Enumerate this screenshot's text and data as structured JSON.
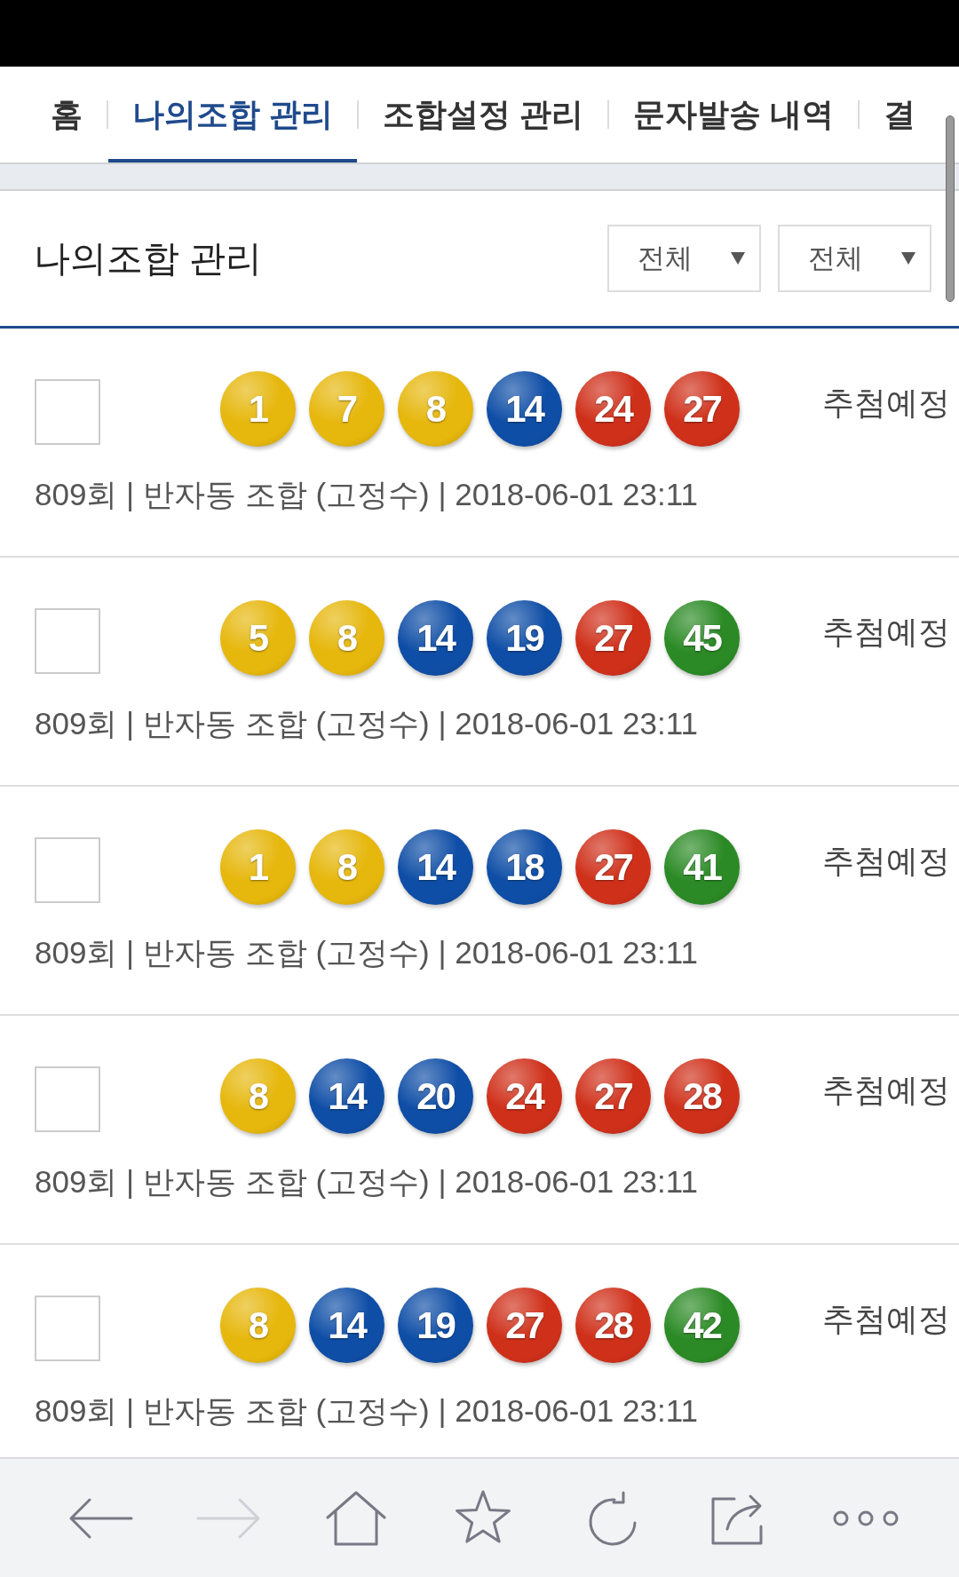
{
  "tabs": [
    {
      "label": "홈",
      "selected": false
    },
    {
      "label": "나의조합 관리",
      "selected": true
    },
    {
      "label": "조합설정 관리",
      "selected": false
    },
    {
      "label": "문자발송 내역",
      "selected": false
    },
    {
      "label": "결",
      "selected": false
    }
  ],
  "header": {
    "title": "나의조합 관리",
    "filters": [
      {
        "value": "전체"
      },
      {
        "value": "전체"
      }
    ]
  },
  "rows": [
    {
      "checked": false,
      "balls": [
        {
          "number": "1",
          "color": "#e6b70c"
        },
        {
          "number": "7",
          "color": "#e6b70c"
        },
        {
          "number": "8",
          "color": "#e6b70c"
        },
        {
          "number": "14",
          "color": "#0f4ea6"
        },
        {
          "number": "24",
          "color": "#cf301a"
        },
        {
          "number": "27",
          "color": "#cf301a"
        }
      ],
      "status": "추첨예정",
      "info": "809회 | 반자동 조합 (고정수) | 2018-06-01 23:11"
    },
    {
      "checked": false,
      "balls": [
        {
          "number": "5",
          "color": "#e6b70c"
        },
        {
          "number": "8",
          "color": "#e6b70c"
        },
        {
          "number": "14",
          "color": "#0f4ea6"
        },
        {
          "number": "19",
          "color": "#0f4ea6"
        },
        {
          "number": "27",
          "color": "#cf301a"
        },
        {
          "number": "45",
          "color": "#2b8a25"
        }
      ],
      "status": "추첨예정",
      "info": "809회 | 반자동 조합 (고정수) | 2018-06-01 23:11"
    },
    {
      "checked": false,
      "balls": [
        {
          "number": "1",
          "color": "#e6b70c"
        },
        {
          "number": "8",
          "color": "#e6b70c"
        },
        {
          "number": "14",
          "color": "#0f4ea6"
        },
        {
          "number": "18",
          "color": "#0f4ea6"
        },
        {
          "number": "27",
          "color": "#cf301a"
        },
        {
          "number": "41",
          "color": "#2b8a25"
        }
      ],
      "status": "추첨예정",
      "info": "809회 | 반자동 조합 (고정수) | 2018-06-01 23:11"
    },
    {
      "checked": false,
      "balls": [
        {
          "number": "8",
          "color": "#e6b70c"
        },
        {
          "number": "14",
          "color": "#0f4ea6"
        },
        {
          "number": "20",
          "color": "#0f4ea6"
        },
        {
          "number": "24",
          "color": "#cf301a"
        },
        {
          "number": "27",
          "color": "#cf301a"
        },
        {
          "number": "28",
          "color": "#cf301a"
        }
      ],
      "status": "추첨예정",
      "info": "809회 | 반자동 조합 (고정수) | 2018-06-01 23:11"
    },
    {
      "checked": false,
      "balls": [
        {
          "number": "8",
          "color": "#e6b70c"
        },
        {
          "number": "14",
          "color": "#0f4ea6"
        },
        {
          "number": "19",
          "color": "#0f4ea6"
        },
        {
          "number": "27",
          "color": "#cf301a"
        },
        {
          "number": "28",
          "color": "#cf301a"
        },
        {
          "number": "42",
          "color": "#2b8a25"
        }
      ],
      "status": "추첨예정",
      "info": "809회 | 반자동 조합 (고정수) | 2018-06-01 23:11"
    }
  ],
  "toolbar": [
    {
      "kind": "back",
      "disabled": false
    },
    {
      "kind": "forward",
      "disabled": true
    },
    {
      "kind": "home",
      "disabled": false
    },
    {
      "kind": "bookmark",
      "disabled": false
    },
    {
      "kind": "refresh",
      "disabled": false
    },
    {
      "kind": "share",
      "disabled": false
    },
    {
      "kind": "more",
      "disabled": false
    }
  ]
}
